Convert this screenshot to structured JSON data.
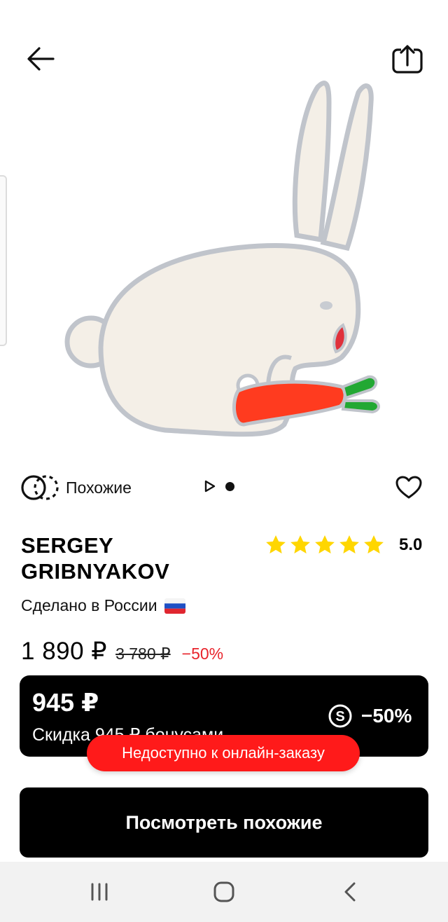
{
  "header": {
    "back_icon": "arrow-left-icon",
    "share_icon": "share-icon"
  },
  "gallery": {
    "image_subject": "bunny-with-carrot-brooch",
    "similar_label": "Похожие",
    "similar_icon": "similar-circles-icon",
    "play_icon": "play-icon",
    "favorite_icon": "heart-icon"
  },
  "product": {
    "brand": "SERGEY GRIBNYAKOV",
    "rating": "5.0",
    "stars": 5,
    "origin": "Сделано в России",
    "flag_icon": "russia-flag-icon"
  },
  "pricing": {
    "price": "1 890 ₽",
    "old_price": "3 780 ₽",
    "discount": "−50%"
  },
  "bonus": {
    "amount": "945 ₽",
    "description": "Скидка 945 ₽ бонусами",
    "percent": "−50%",
    "icon": "bonus-s-icon"
  },
  "notice": {
    "unavailable": "Недоступно к онлайн-заказу"
  },
  "cta": {
    "label": "Посмотреть похожие"
  },
  "system_nav": {
    "recents_icon": "recents-icon",
    "home_icon": "home-icon",
    "back_icon": "nav-back-icon"
  },
  "colors": {
    "accent_red": "#e8232b",
    "pill_red": "#ff1a1a",
    "star_yellow": "#ffd600",
    "dark": "#000000"
  }
}
